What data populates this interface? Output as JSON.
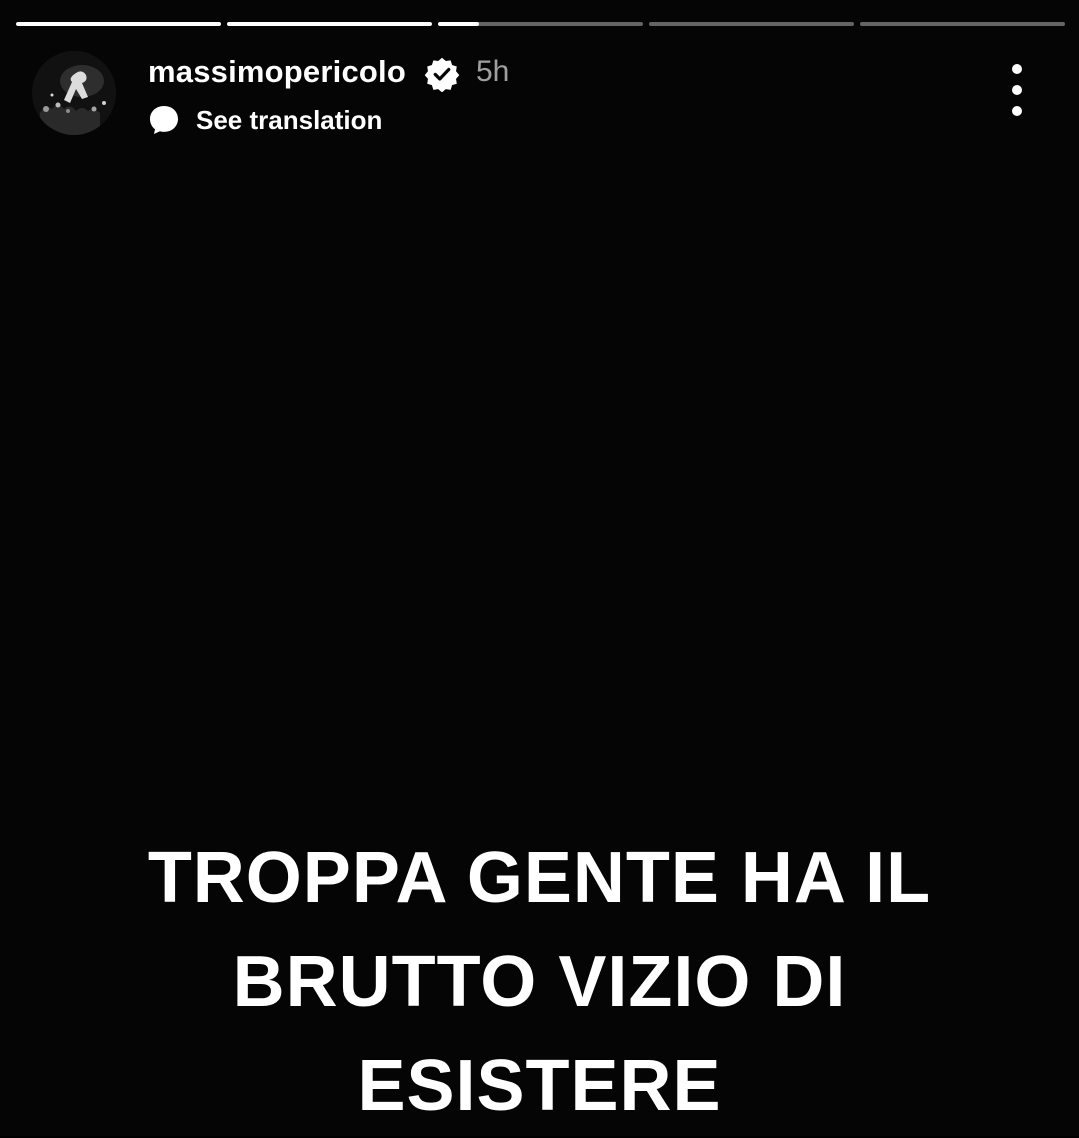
{
  "story": {
    "progress": {
      "segments": [
        1,
        1,
        0.2,
        0,
        0
      ],
      "fill_color": "#ffffff",
      "track_color": "rgba(255,255,255,0.38)"
    },
    "header": {
      "username": "massimopericolo",
      "verified_icon": "verified-badge-icon",
      "time_ago": "5h",
      "translate_label": "See translation",
      "translate_icon": "speech-bubble-icon",
      "more_icon": "more-vertical-icon"
    },
    "caption": {
      "lines": [
        "TROPPA GENTE HA IL",
        "BRUTTO VIZIO DI",
        "ESISTERE"
      ]
    }
  }
}
